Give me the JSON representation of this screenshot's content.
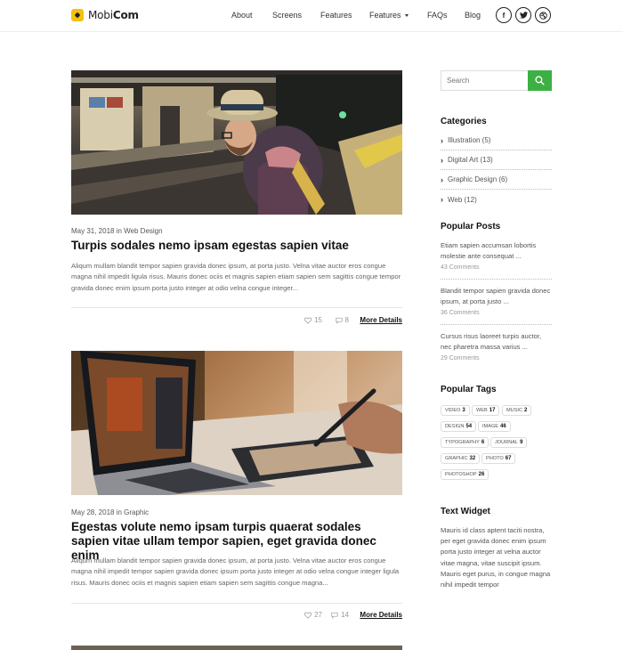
{
  "brand": {
    "name_light": "Mobi",
    "name_bold": "Com"
  },
  "nav": {
    "items": [
      "About",
      "Screens",
      "Features",
      "Features",
      "FAQs",
      "Blog"
    ],
    "social": [
      "f",
      "t",
      "d"
    ]
  },
  "posts": [
    {
      "meta": "May 31, 2018 in Web Design",
      "title": "Turpis sodales nemo ipsam egestas sapien vitae",
      "excerpt": "Aliqum mullam blandit tempor sapien gravida donec ipsum, at porta justo. Velna vitae auctor eros congue magna nihil impedit ligula risus. Mauris donec ociis et magnis sapien etiam sapien sem sagittis congue tempor gravida donec enim ipsum porta justo integer at odio velna congue integer...",
      "likes": "15",
      "comments": "8",
      "more": "More Details"
    },
    {
      "meta": "May 28, 2018 in Graphic",
      "title": "Egestas volute nemo ipsam turpis quaerat sodales sapien vitae ullam tempor sapien, eget gravida donec enim",
      "excerpt": "Aliqum mullam blandit tempor sapien gravida donec ipsum, at porta justo. Velna vitae auctor eros congue magna nihil impedit tempor sapien gravida donec ipsum porta justo integer at odio velna congue integer ligula risus. Mauris donec ociis et magnis sapien etiam sapien sem sagittis congue magna...",
      "likes": "27",
      "comments": "14",
      "more": "More Details"
    }
  ],
  "sidebar": {
    "search_placeholder": "Search",
    "categories_heading": "Categories",
    "categories": [
      "Illustration (5)",
      "Digital Art (13)",
      "Graphic Design (6)",
      "Web (12)"
    ],
    "popular_posts_heading": "Popular Posts",
    "popular_posts": [
      {
        "title": "Etiam sapien accumsan lobortis molestie ante consequat ...",
        "comments": "43 Comments"
      },
      {
        "title": "Blandit tempor sapien gravida donec ipsum, at porta justo ...",
        "comments": "36 Comments"
      },
      {
        "title": "Cursus risus laoreet turpis auctor, nec pharetra massa varius ...",
        "comments": "29 Comments"
      }
    ],
    "popular_tags_heading": "Popular Tags",
    "tags": [
      {
        "name": "VIDEO",
        "count": "3"
      },
      {
        "name": "WEB",
        "count": "17"
      },
      {
        "name": "MUSIC",
        "count": "2"
      },
      {
        "name": "DESIGN",
        "count": "54"
      },
      {
        "name": "IMAGE",
        "count": "46"
      },
      {
        "name": "TYPOGRAPHY",
        "count": "6"
      },
      {
        "name": "JOURNAL",
        "count": "9"
      },
      {
        "name": "GRAPHIC",
        "count": "32"
      },
      {
        "name": "PHOTO",
        "count": "67"
      },
      {
        "name": "PHOTOSHOP",
        "count": "26"
      }
    ],
    "text_widget_heading": "Text Widget",
    "text_widget_body": "Mauris id class aptent taciti nostra, per eget gravida donec enim ipsum porta justo integer at velna auctor vitae magna, vitae suscipit ipsum. Mauris eget purus, in congue magna nihil impedit tempor"
  },
  "colors": {
    "accent": "#3cb043",
    "logo": "#f4c20d",
    "title": "#111111"
  }
}
